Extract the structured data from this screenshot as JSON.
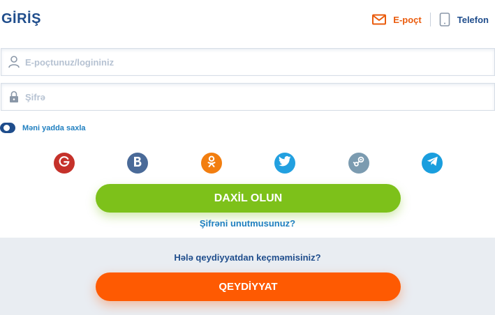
{
  "header": {
    "title": "GİRİŞ"
  },
  "method_switch": {
    "email_label": "E-poçt",
    "phone_label": "Telefon",
    "active": "email"
  },
  "form": {
    "login_placeholder": "E-poçtunuz/logininiz",
    "password_placeholder": "Şifrə",
    "remember_label": "Məni yadda saxla",
    "remember_checked": true
  },
  "social": [
    "google-icon",
    "vk-icon",
    "odnoklassniki-icon",
    "twitter-icon",
    "steam-icon",
    "telegram-icon"
  ],
  "actions": {
    "login_button": "DAXİL OLUN",
    "forgot_link": "Şifrəni unutmusunuz?"
  },
  "register": {
    "question": "Hələ qeydiyyatdan keçməmisiniz?",
    "button": "QEYDİYYAT"
  },
  "colors": {
    "brand_blue": "#1f4d8c",
    "link_blue": "#1f7fc0",
    "accent_orange": "#fe5a02",
    "login_green": "#7dc11a"
  }
}
